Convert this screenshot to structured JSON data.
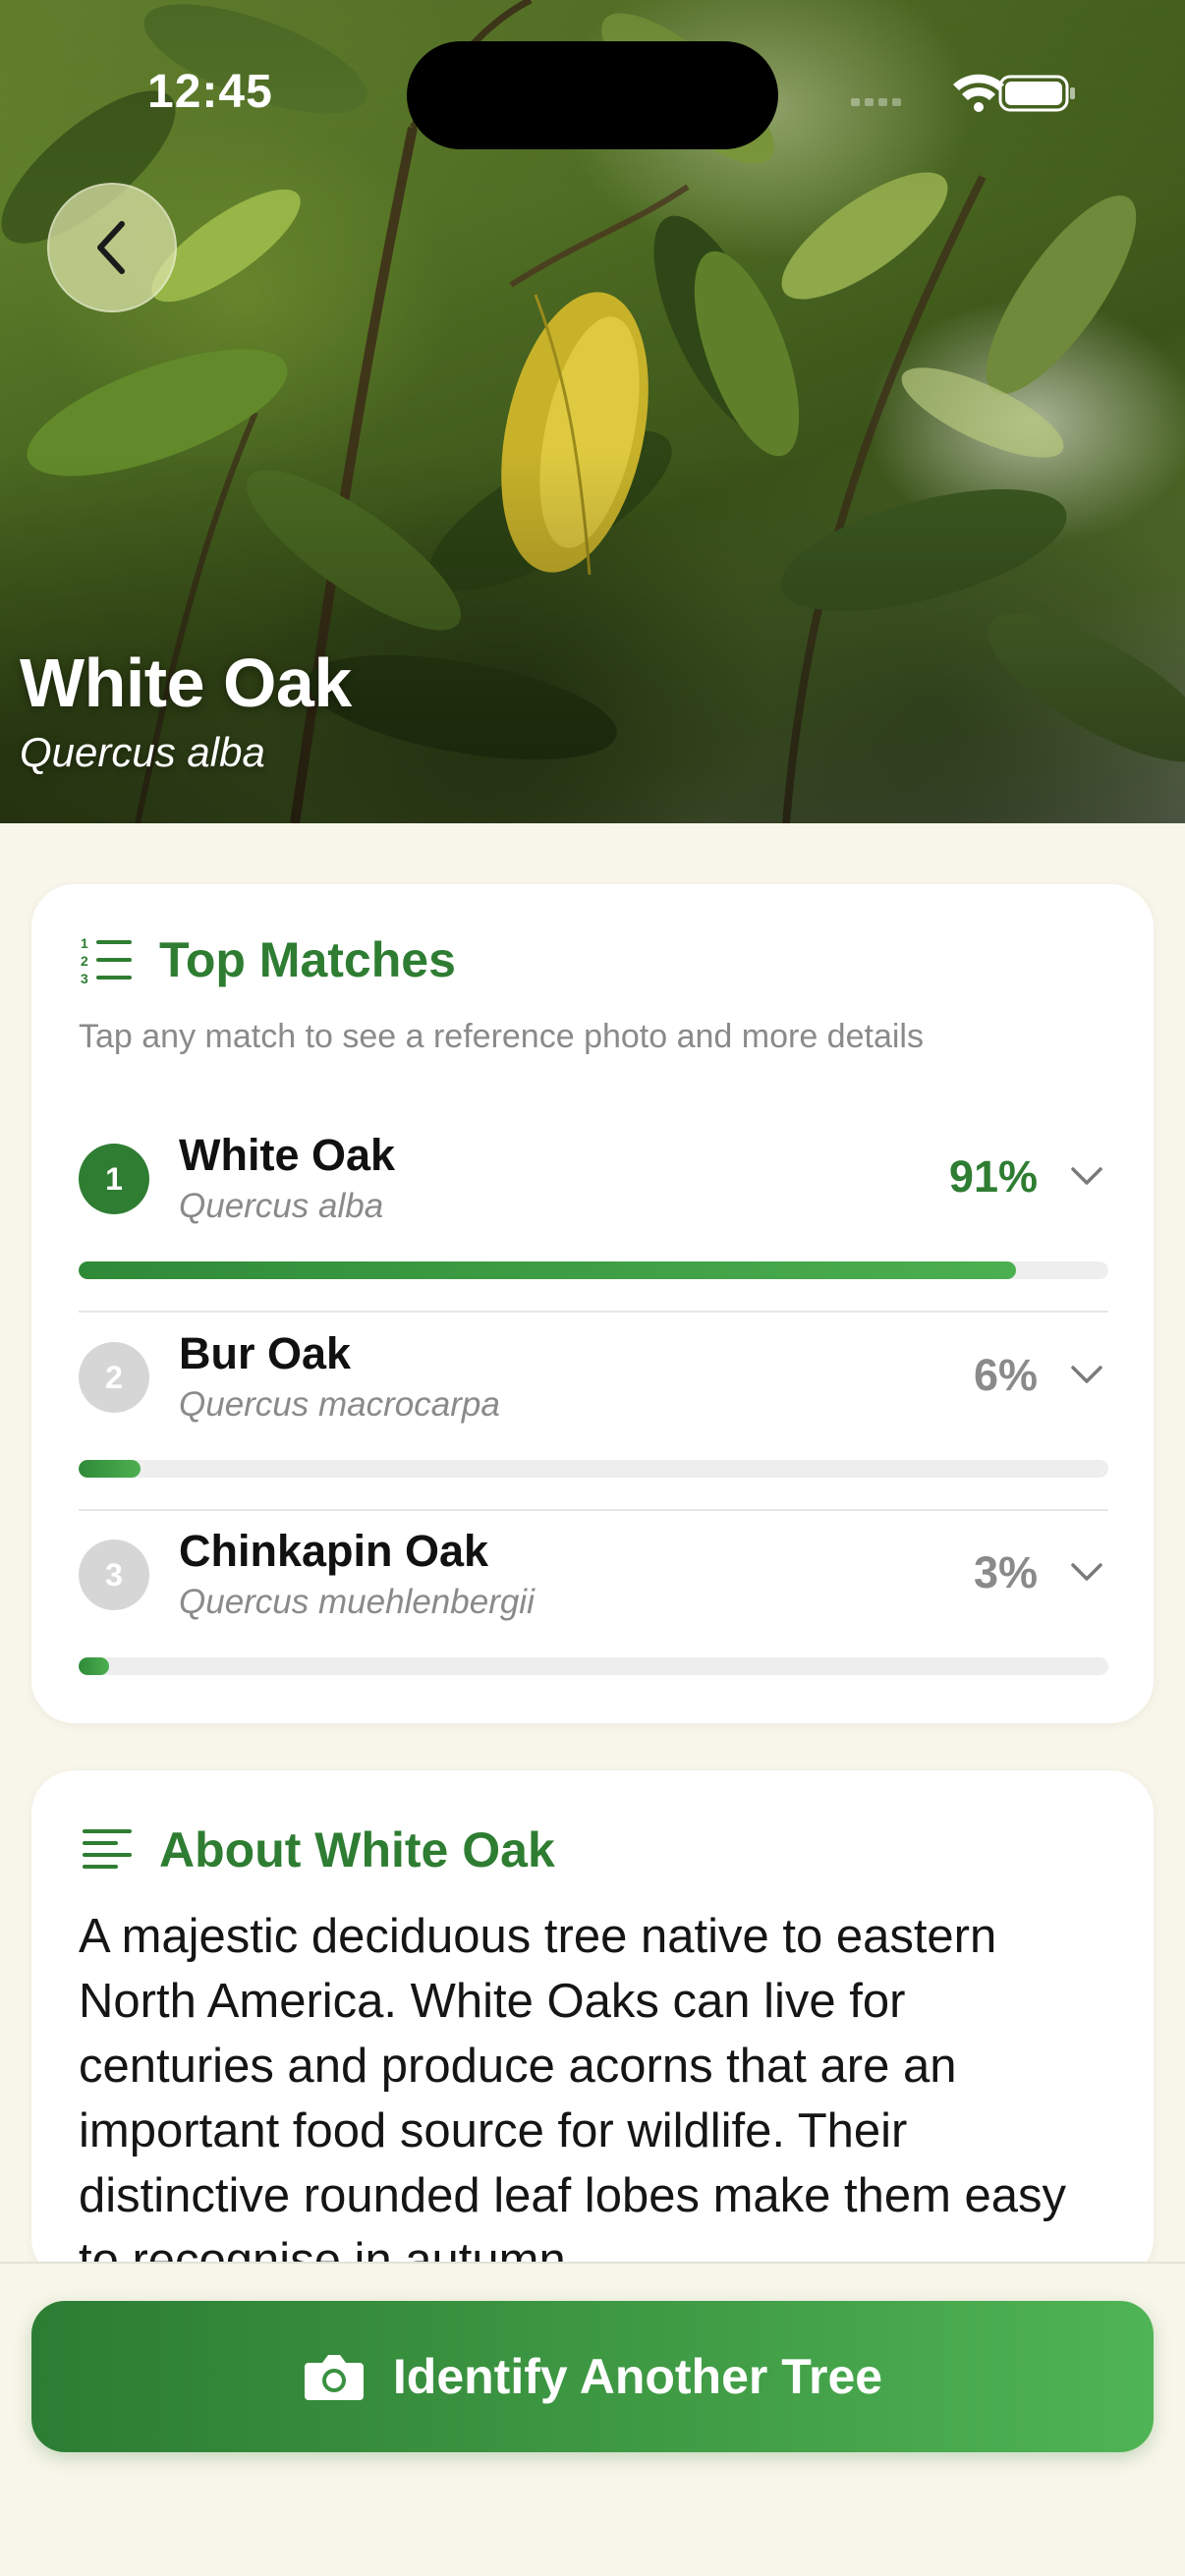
{
  "status_bar": {
    "time": "12:45"
  },
  "hero": {
    "title": "White Oak",
    "subtitle": "Quercus alba"
  },
  "top_matches": {
    "title": "Top Matches",
    "hint": "Tap any match to see a reference photo and more details",
    "items": [
      {
        "rank": "1",
        "name": "White Oak",
        "scientific": "Quercus alba",
        "percent_label": "91%",
        "confidence": 0.91,
        "highlight": true
      },
      {
        "rank": "2",
        "name": "Bur Oak",
        "scientific": "Quercus macrocarpa",
        "percent_label": "6%",
        "confidence": 0.06,
        "highlight": false
      },
      {
        "rank": "3",
        "name": "Chinkapin Oak",
        "scientific": "Quercus muehlenbergii",
        "percent_label": "3%",
        "confidence": 0.03,
        "highlight": false
      }
    ]
  },
  "about": {
    "title": "About White Oak",
    "text": "A majestic deciduous tree native to eastern North America. White Oaks can live for centuries and produce acorns that are an important food source for wildlife. Their distinctive rounded leaf lobes make them easy to recognise in autumn."
  },
  "cta": {
    "label": "Identify Another Tree"
  },
  "colors": {
    "accent": "#2e7d32",
    "accent_light": "#4caf50",
    "background": "#f8f6ea",
    "muted_rank": "#d6d6d6",
    "muted_text": "#8a8a8a"
  },
  "icons": {
    "back": "chevron-left-icon",
    "matches": "numbered-list-icon",
    "about": "text-lines-icon",
    "expand": "chevron-down-icon",
    "camera": "camera-icon"
  }
}
